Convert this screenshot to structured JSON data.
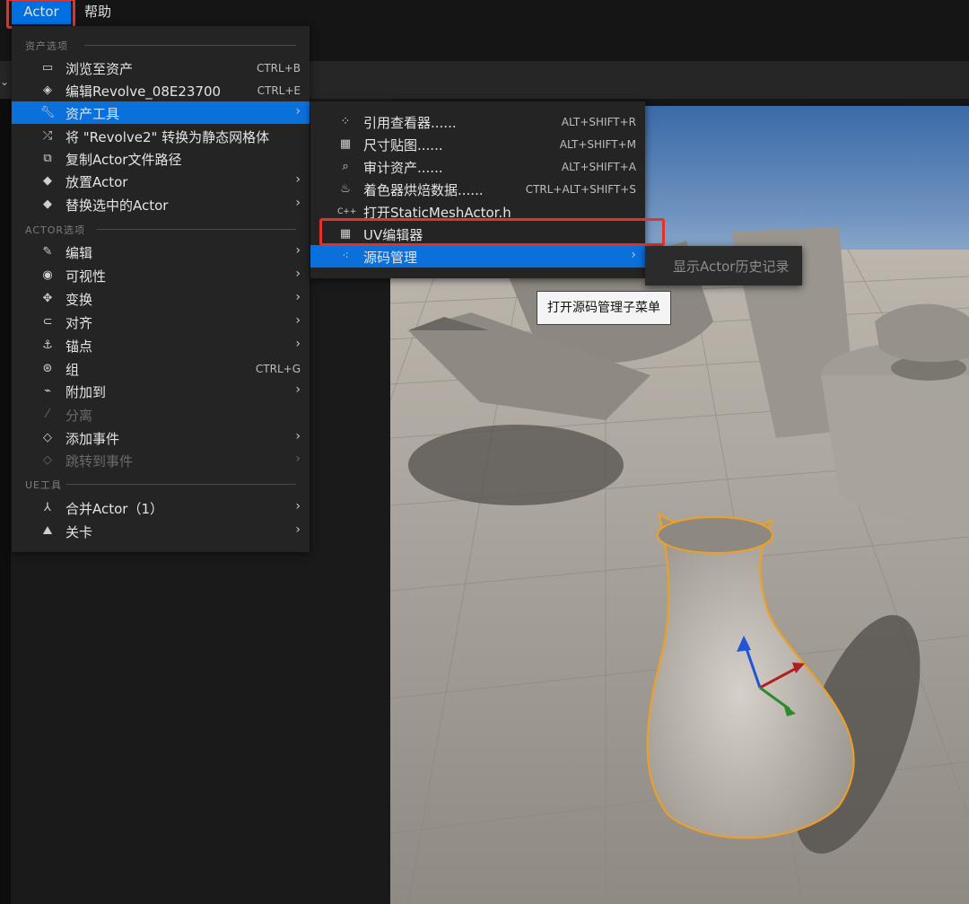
{
  "menubar": {
    "actor": "Actor",
    "help": "帮助"
  },
  "main_menu": {
    "section_asset": "资产选项",
    "section_actor": "ACTOR选项",
    "section_ue": "UE工具",
    "items": [
      {
        "label": "浏览至资产",
        "shortcut": "CTRL+B",
        "icon": "folder-browse-icon"
      },
      {
        "label": "编辑Revolve_08E23700",
        "shortcut": "CTRL+E",
        "icon": "cube-edit-icon"
      },
      {
        "label": "资产工具",
        "icon": "wrench-icon",
        "submenu": true,
        "selected": true
      },
      {
        "label": "将 \"Revolve2\" 转换为静态网格体",
        "icon": "convert-icon"
      },
      {
        "label": "复制Actor文件路径",
        "icon": "copy-path-icon"
      },
      {
        "label": "放置Actor",
        "icon": "place-actor-icon",
        "submenu": true
      },
      {
        "label": "替换选中的Actor",
        "icon": "replace-actor-icon",
        "submenu": true
      },
      {
        "label": "编辑",
        "icon": "pencil-icon",
        "submenu": true
      },
      {
        "label": "可视性",
        "icon": "eye-icon",
        "submenu": true
      },
      {
        "label": "变换",
        "icon": "transform-icon",
        "submenu": true
      },
      {
        "label": "对齐",
        "icon": "snap-icon",
        "submenu": true
      },
      {
        "label": "锚点",
        "icon": "pivot-icon",
        "submenu": true
      },
      {
        "label": "组",
        "shortcut": "CTRL+G",
        "icon": "group-icon"
      },
      {
        "label": "附加到",
        "icon": "attach-icon",
        "submenu": true
      },
      {
        "label": "分离",
        "icon": "detach-icon",
        "disabled": true
      },
      {
        "label": "添加事件",
        "icon": "event-icon",
        "submenu": true
      },
      {
        "label": "跳转到事件",
        "icon": "jump-event-icon",
        "submenu": true,
        "disabled": true
      },
      {
        "label": "合并Actor（1）",
        "icon": "merge-icon",
        "submenu": true
      },
      {
        "label": "关卡",
        "icon": "level-icon",
        "submenu": true
      }
    ]
  },
  "sub_menu": {
    "items": [
      {
        "label": "引用查看器......",
        "shortcut": "ALT+SHIFT+R",
        "icon": "reference-viewer-icon"
      },
      {
        "label": "尺寸贴图......",
        "shortcut": "ALT+SHIFT+M",
        "icon": "size-map-icon"
      },
      {
        "label": "审计资产......",
        "shortcut": "ALT+SHIFT+A",
        "icon": "audit-icon"
      },
      {
        "label": "着色器烘焙数据......",
        "shortcut": "CTRL+ALT+SHIFT+S",
        "icon": "shader-icon"
      },
      {
        "label": "打开StaticMeshActor.h",
        "icon": "cpp-file-icon"
      },
      {
        "label": "UV编辑器",
        "icon": "uv-editor-icon"
      },
      {
        "label": "源码管理",
        "icon": "source-control-icon",
        "submenu": true,
        "selected": true
      }
    ]
  },
  "third_menu": {
    "label": "显示Actor历史记录"
  },
  "tooltip": "打开源码管理子菜单",
  "colors": {
    "selection": "#0a70dc",
    "highlight_box": "#e8302a",
    "menu_bg": "#242424",
    "outline": "#f0a020"
  }
}
